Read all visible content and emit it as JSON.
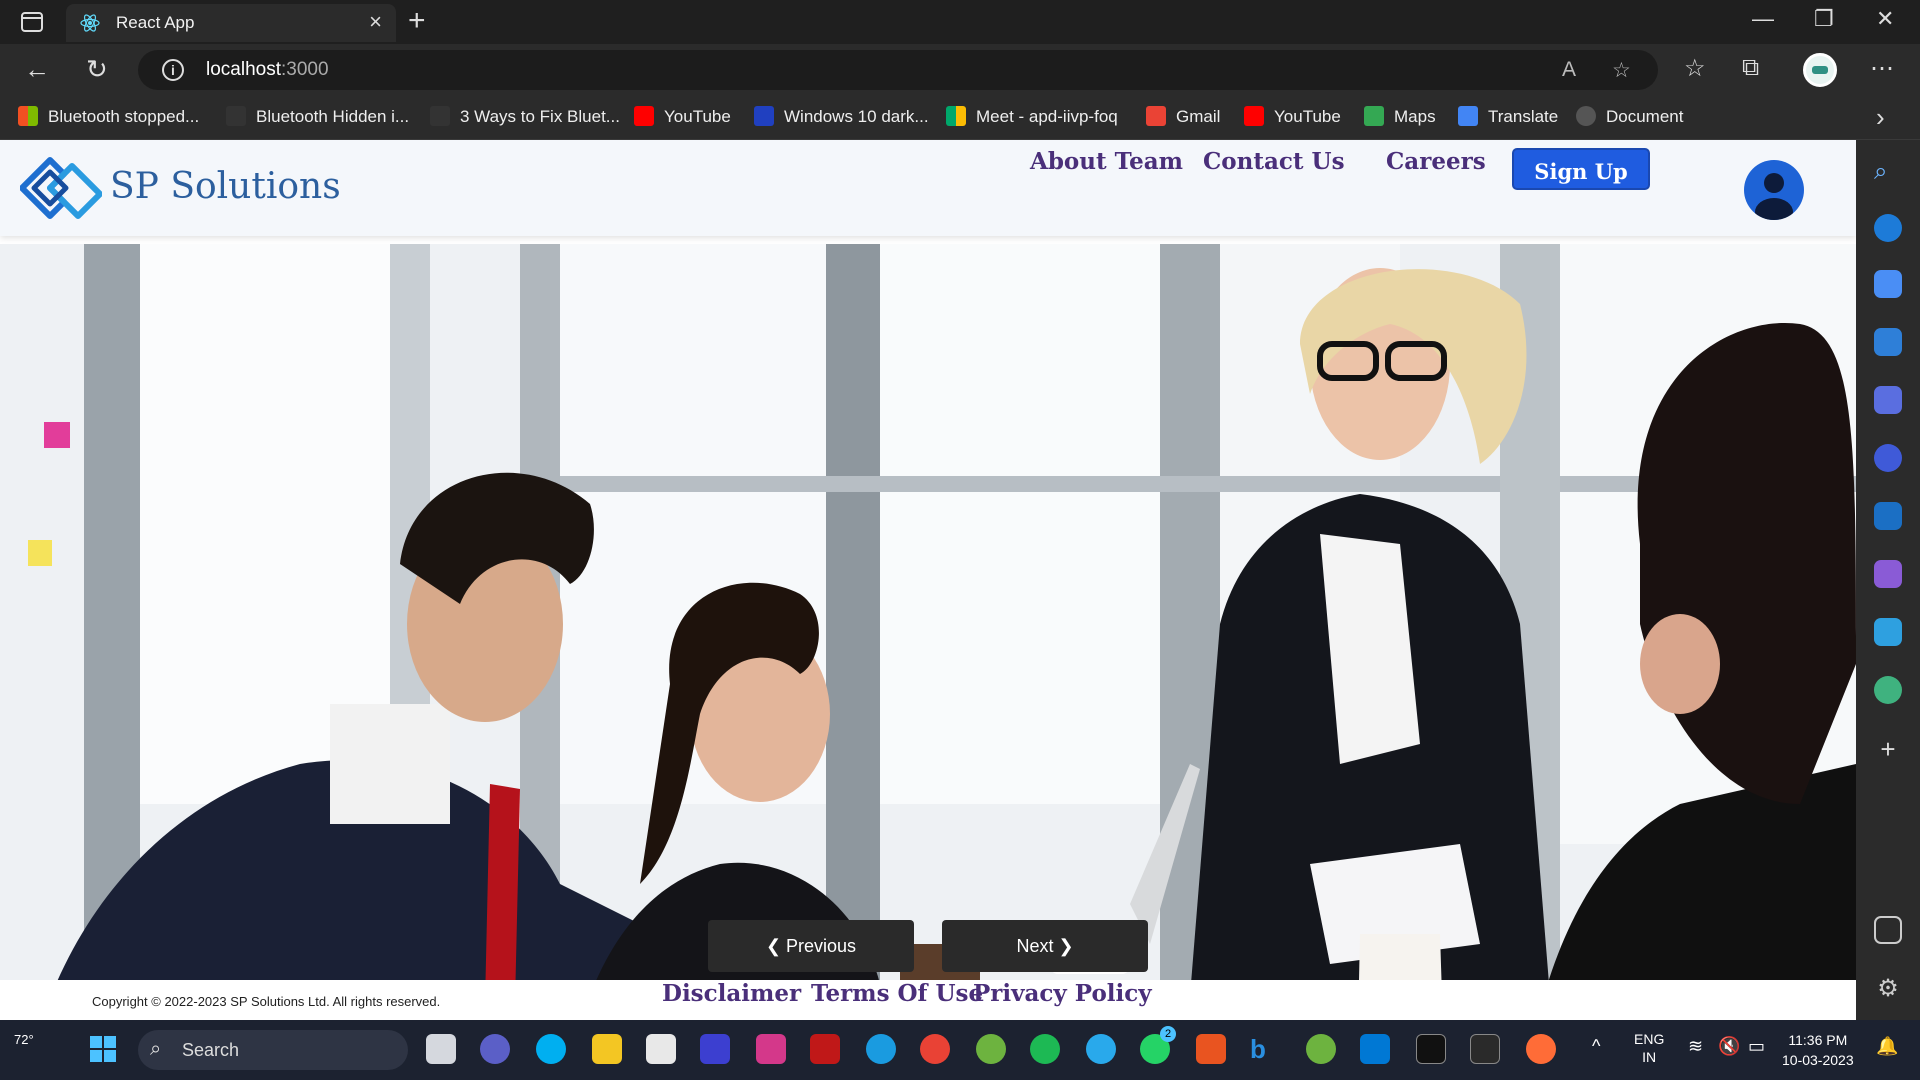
{
  "browser": {
    "tab_title": "React App",
    "url_host": "localhost",
    "url_port": ":3000",
    "bookmarks": [
      {
        "label": "Bluetooth stopped...",
        "color": "#f25022"
      },
      {
        "label": "Bluetooth Hidden i...",
        "color": "#444444"
      },
      {
        "label": "3 Ways to Fix Bluet...",
        "color": "#444444"
      },
      {
        "label": "YouTube",
        "color": "#ff0000"
      },
      {
        "label": "Windows 10 dark...",
        "color": "#2040c0"
      },
      {
        "label": "Meet - apd-iivp-foq",
        "color": "#00a86b"
      },
      {
        "label": "Gmail",
        "color": "#ea4335"
      },
      {
        "label": "YouTube",
        "color": "#ff0000"
      },
      {
        "label": "Maps",
        "color": "#34a853"
      },
      {
        "label": "Translate",
        "color": "#4285f4"
      },
      {
        "label": "Document",
        "color": "#555555"
      }
    ]
  },
  "site": {
    "brand": "SP Solutions",
    "nav": [
      "About Team",
      "Contact Us",
      "Careers"
    ],
    "signup_label": "Sign Up",
    "carousel": {
      "prev_label": "❮ Previous",
      "next_label": "Next ❯"
    },
    "footer": {
      "copyright": "Copyright © 2022-2023 SP Solutions Ltd. All rights reserved.",
      "links": [
        "Disclaimer",
        "Terms Of Use",
        "Privacy Policy"
      ]
    },
    "accent_color": "#1f5ce0",
    "link_color": "#4a2f7a"
  },
  "taskbar": {
    "weather": "72°",
    "search_label": "Search",
    "lang": "ENG",
    "region": "IN",
    "time": "11:36 PM",
    "date": "10-03-2023",
    "whatsapp_badge": "2"
  }
}
